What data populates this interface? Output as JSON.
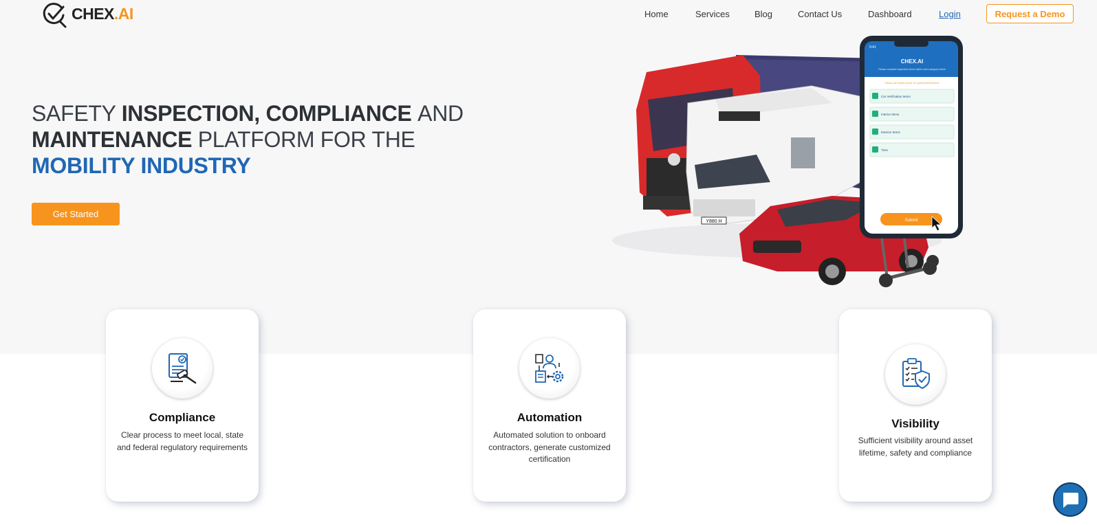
{
  "brand": {
    "logo_part1": "CHEX",
    "logo_part2": ".AI",
    "accent": "#f7941d",
    "primary": "#1f67b4"
  },
  "nav": {
    "items": [
      "Home",
      "Services",
      "Blog",
      "Contact Us",
      "Dashboard"
    ],
    "login": "Login",
    "demo": "Request a Demo"
  },
  "hero": {
    "line1_a": "SAFETY ",
    "line1_b": "INSPECTION, COMPLIANCE ",
    "line1_c": "AND",
    "line2_a": "MAINTENANCE ",
    "line2_b": "PLATFORM FOR THE",
    "line3": "MOBILITY INDUSTRY",
    "cta": "Get Started"
  },
  "phone": {
    "time": "9:41",
    "logo": "CHEX.AI",
    "subtitle": "Please complete inspection items within each category below",
    "notice": "Please use mobile phone for optimal performance",
    "items": [
      "Car Verification Items",
      "Interior Items",
      "Exterior Items",
      "Tires"
    ],
    "submit": "Submit"
  },
  "vehicle": {
    "plate": "Y880 H"
  },
  "features": [
    {
      "title": "Compliance",
      "desc": "Clear process to meet local, state and federal regulatory requirements",
      "icon": "compliance-document-gavel-icon"
    },
    {
      "title": "Automation",
      "desc": "Automated solution to onboard contractors, generate customized certification",
      "icon": "automation-person-gear-icon"
    },
    {
      "title": "Visibility",
      "desc": "Sufficient visibility around asset lifetime, safety and compliance",
      "icon": "visibility-checklist-shield-icon"
    }
  ],
  "chat": {
    "icon": "chat-bubble-icon"
  }
}
